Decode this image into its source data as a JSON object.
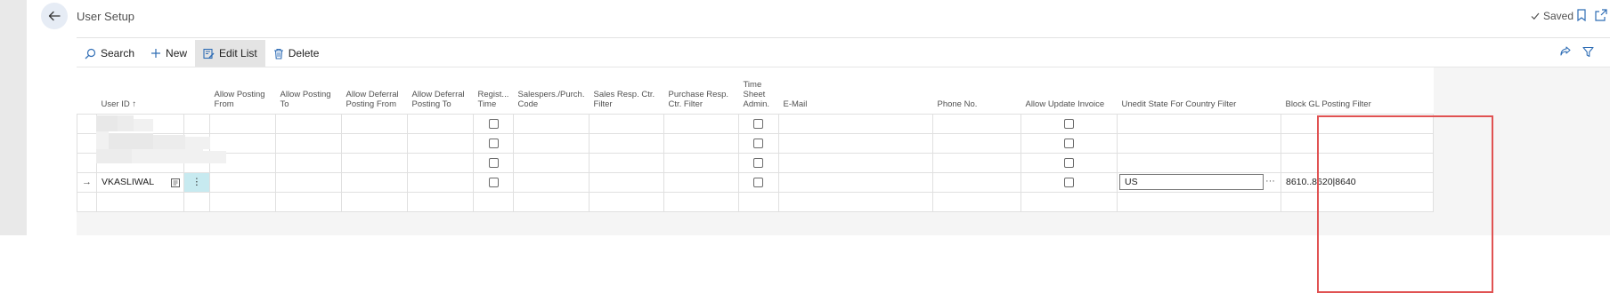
{
  "page": {
    "title": "User Setup",
    "saved_label": "Saved"
  },
  "icons": {
    "back": "arrow-left-icon",
    "saved_check": "check-icon",
    "bookmark": "bookmark-icon",
    "open_new": "open-new-window-icon",
    "share": "share-icon",
    "filter": "filter-icon"
  },
  "actions": [
    {
      "label": "Search",
      "icon": "search-icon"
    },
    {
      "label": "New",
      "icon": "plus-icon"
    },
    {
      "label": "Edit List",
      "icon": "edit-list-icon",
      "active": true
    },
    {
      "label": "Delete",
      "icon": "trash-icon"
    }
  ],
  "columns": [
    {
      "key": "user_id",
      "label": "User ID ↑"
    },
    {
      "key": "allow_posting_from",
      "label": "Allow Posting From"
    },
    {
      "key": "allow_posting_to",
      "label": "Allow Posting To"
    },
    {
      "key": "allow_deferral_posting_from",
      "label": "Allow Deferral Posting From"
    },
    {
      "key": "allow_deferral_posting_to",
      "label": "Allow Deferral Posting To"
    },
    {
      "key": "register_time",
      "label": "Regist... Time"
    },
    {
      "key": "salespers_purch_code",
      "label": "Salespers./Purch. Code"
    },
    {
      "key": "sales_resp_ctr_filter",
      "label": "Sales Resp. Ctr. Filter"
    },
    {
      "key": "purchase_resp_ctr_filter",
      "label": "Purchase Resp. Ctr. Filter"
    },
    {
      "key": "time_sheet_admin",
      "label": "Time Sheet Admin."
    },
    {
      "key": "email",
      "label": "E-Mail"
    },
    {
      "key": "phone_no",
      "label": "Phone No."
    },
    {
      "key": "allow_update_invoice",
      "label": "Allow Update Invoice"
    },
    {
      "key": "unedit_state_for_country_filter",
      "label": "Unedit State For Country Filter"
    },
    {
      "key": "block_gl_posting_filter",
      "label": "Block GL Posting Filter"
    }
  ],
  "rows": [
    {
      "user_id": "",
      "register_time": false,
      "time_sheet_admin": false,
      "allow_update_invoice": false,
      "unedit_state_for_country_filter": "",
      "block_gl_posting_filter": ""
    },
    {
      "user_id": "",
      "register_time": false,
      "time_sheet_admin": false,
      "allow_update_invoice": false,
      "unedit_state_for_country_filter": "",
      "block_gl_posting_filter": ""
    },
    {
      "user_id": "",
      "register_time": false,
      "time_sheet_admin": false,
      "allow_update_invoice": false,
      "unedit_state_for_country_filter": "",
      "block_gl_posting_filter": ""
    },
    {
      "user_id": "VKASLIWAL",
      "current": true,
      "register_time": false,
      "time_sheet_admin": false,
      "allow_update_invoice": false,
      "unedit_state_for_country_filter": "US",
      "block_gl_posting_filter": "8610..8620|8640"
    }
  ],
  "colors": {
    "accent": "#2f6db5",
    "highlight_box": "#e05252",
    "active_row_marker": "#c7eaf0"
  }
}
